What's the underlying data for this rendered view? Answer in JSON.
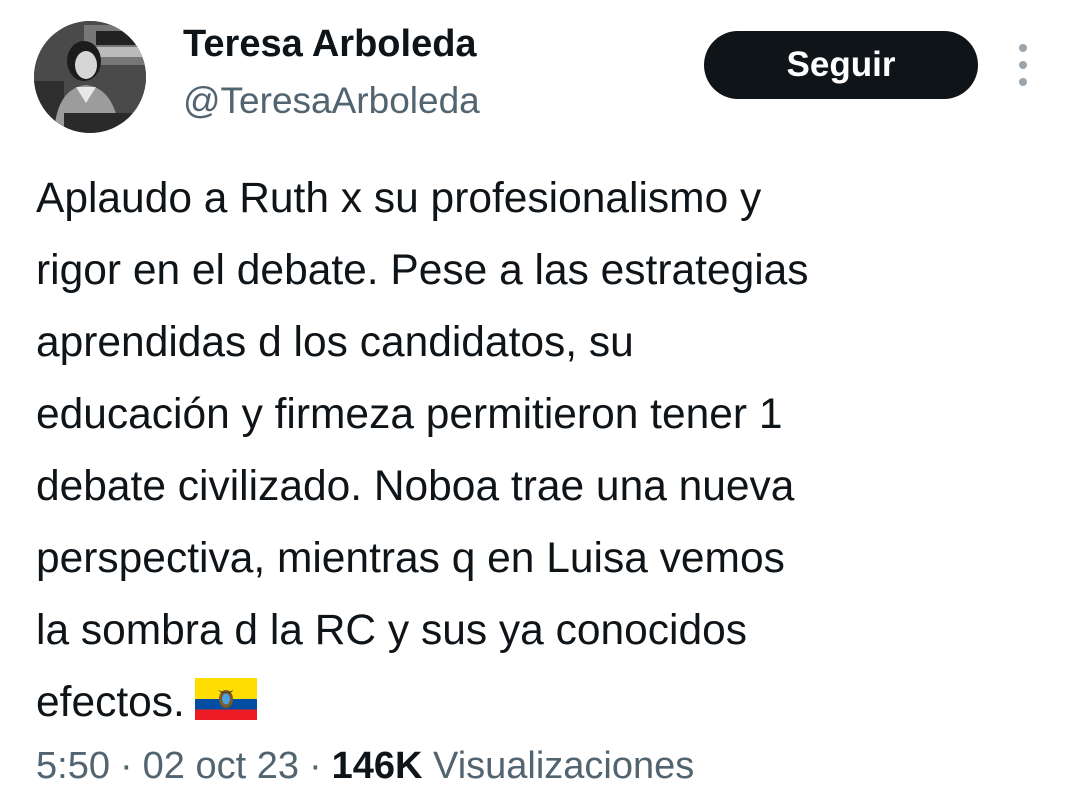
{
  "author": {
    "name": "Teresa Arboleda",
    "handle": "@TeresaArboleda",
    "avatar_icon": "profile-photo"
  },
  "actions": {
    "follow_label": "Seguir",
    "more_icon": "more-options-icon"
  },
  "tweet": {
    "lines": [
      "Aplaudo a Ruth x su profesionalismo y",
      "rigor en el debate. Pese a las estrategias",
      "aprendidas d los candidatos, su",
      "educación y firmeza permitieron tener 1",
      "debate civilizado. Noboa trae una nueva",
      "perspectiva, mientras q en Luisa vemos",
      "la sombra d la RC y sus ya conocidos",
      "efectos."
    ],
    "emoji": "ecuador-flag"
  },
  "meta": {
    "time": "5:50",
    "separator": "·",
    "date": "02 oct 23",
    "views_count": "146K",
    "views_label": "Visualizaciones"
  },
  "colors": {
    "text": "#0f1419",
    "secondary": "#536471",
    "button_bg": "#0f1419",
    "button_text": "#ffffff",
    "flag_yellow": "#ffdd00",
    "flag_blue": "#034ea2",
    "flag_red": "#ed1c24"
  }
}
